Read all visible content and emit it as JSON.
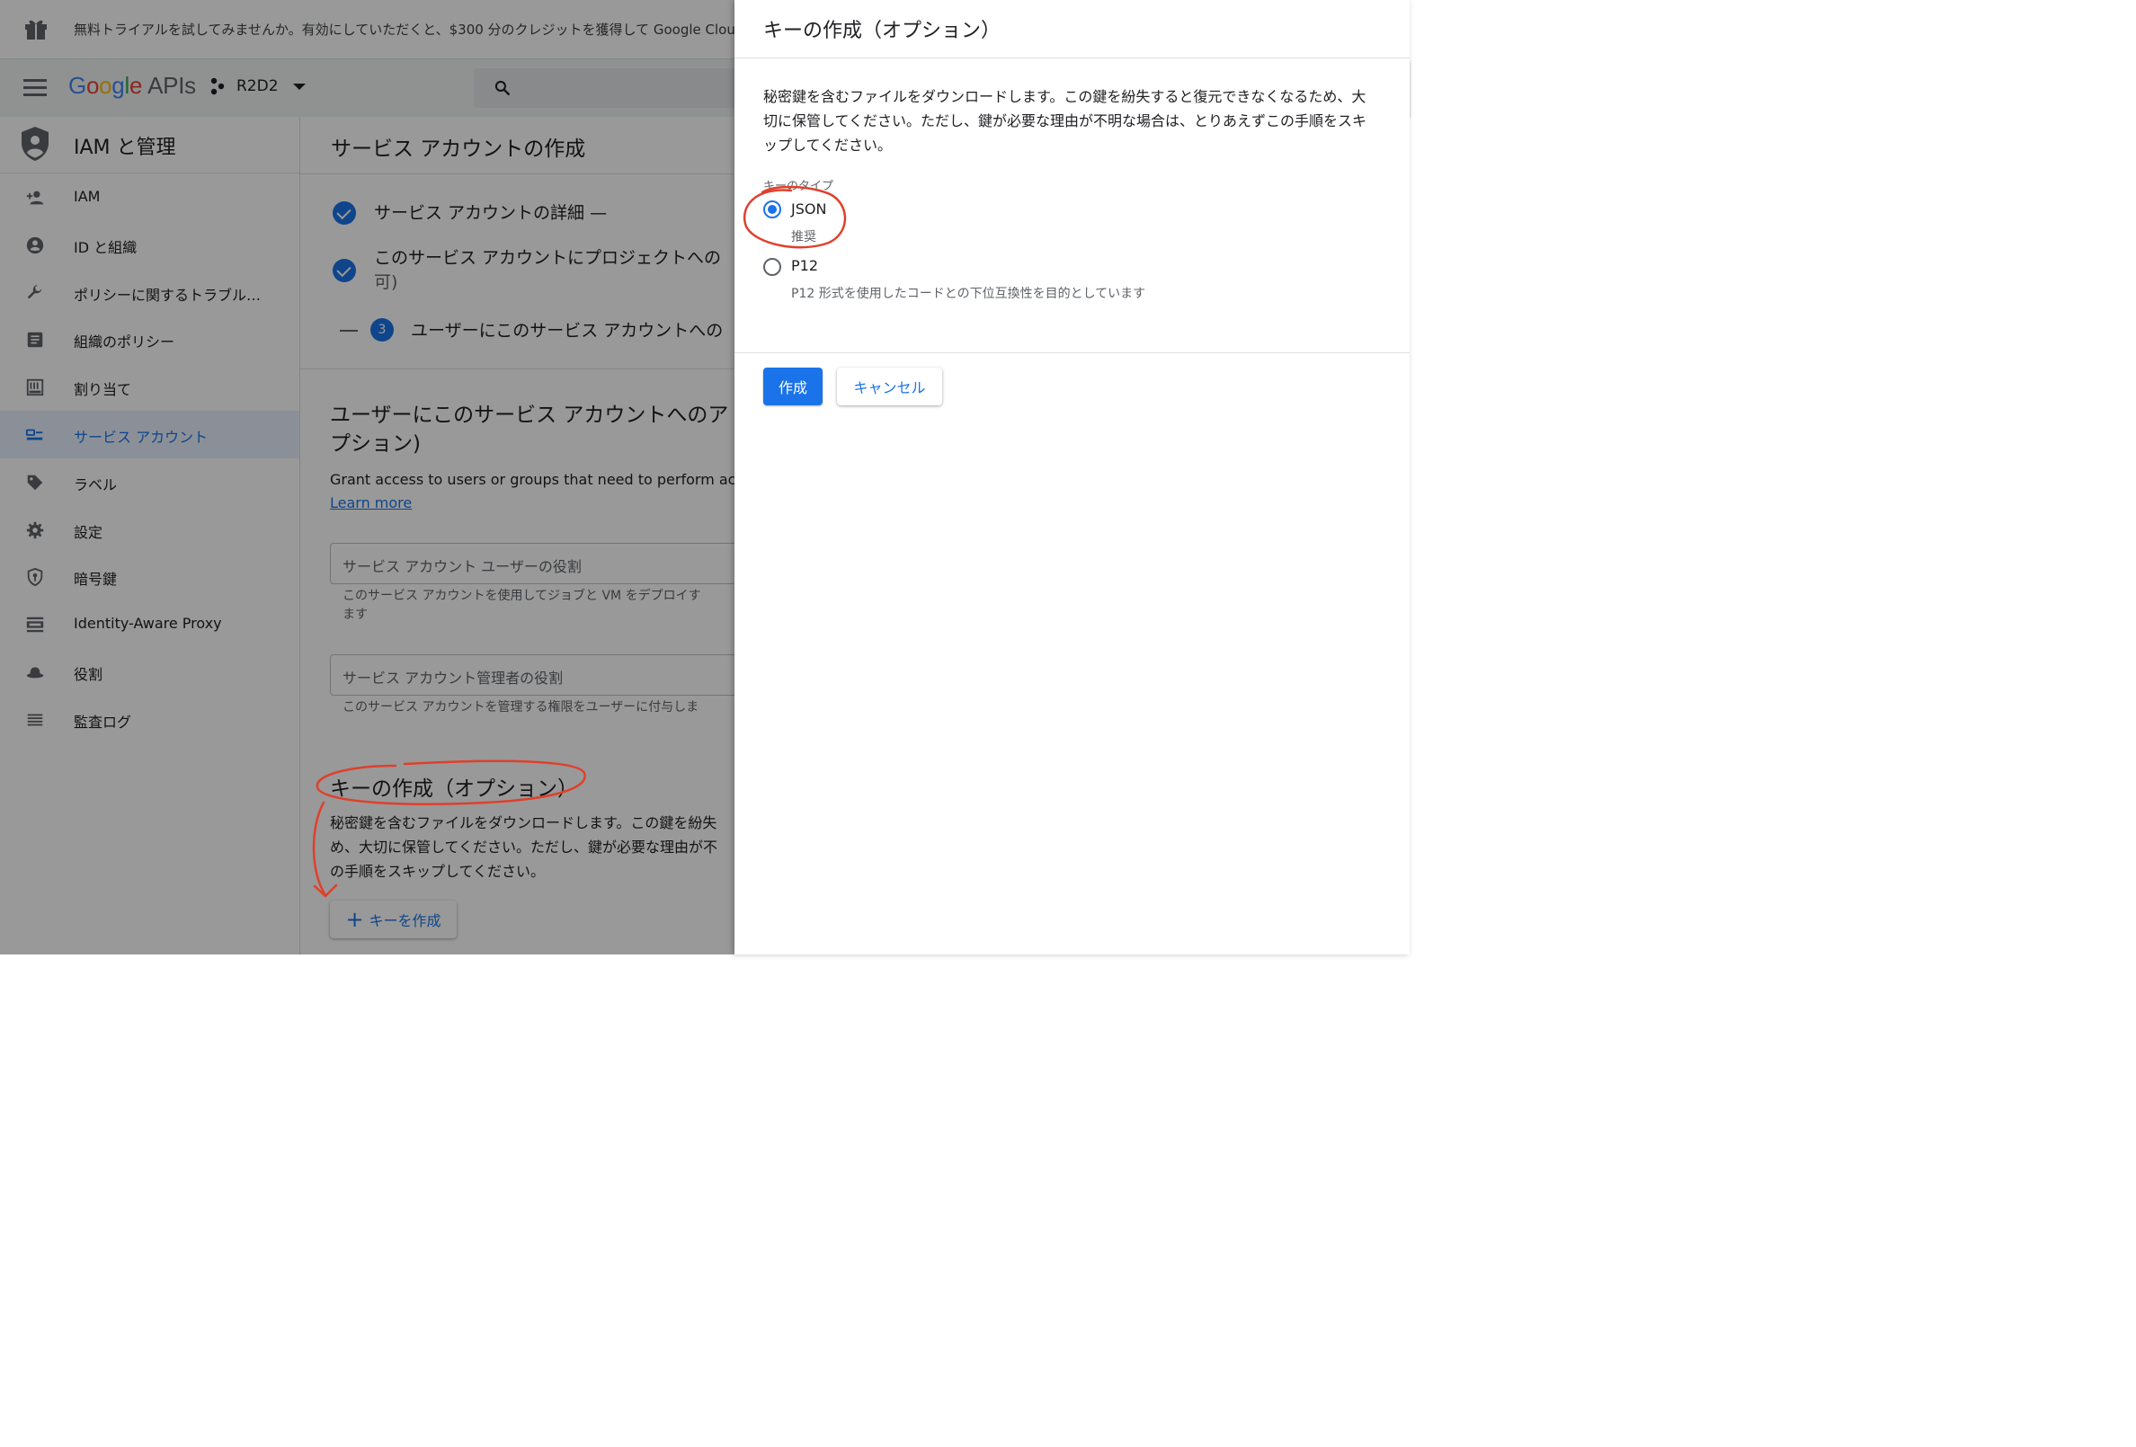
{
  "banner": {
    "text": "無料トライアルを試してみませんか。有効にしていただくと、$300 分のクレジットを獲得して Google Cloud"
  },
  "appbar": {
    "logo_google": "Google",
    "logo_apis": "APIs",
    "project_name": "R2D2"
  },
  "sidebar": {
    "title": "IAM と管理",
    "items": [
      {
        "label": "IAM",
        "icon": "person-add-icon"
      },
      {
        "label": "ID と組織",
        "icon": "account-circle-icon"
      },
      {
        "label": "ポリシーに関するトラブル…",
        "icon": "wrench-icon"
      },
      {
        "label": "組織のポリシー",
        "icon": "list-box-icon"
      },
      {
        "label": "割り当て",
        "icon": "quota-icon"
      },
      {
        "label": "サービス アカウント",
        "icon": "service-account-icon",
        "active": true
      },
      {
        "label": "ラベル",
        "icon": "tag-icon"
      },
      {
        "label": "設定",
        "icon": "gear-icon"
      },
      {
        "label": "暗号鍵",
        "icon": "security-key-icon"
      },
      {
        "label": "Identity-Aware Proxy",
        "icon": "iap-icon"
      },
      {
        "label": "役割",
        "icon": "hat-icon"
      },
      {
        "label": "監査ログ",
        "icon": "log-list-icon"
      }
    ]
  },
  "main": {
    "page_title": "サービス アカウントの作成",
    "steps": [
      {
        "text": "サービス アカウントの詳細 —"
      },
      {
        "text": "このサービス アカウントにプロジェクトへの",
        "text2": "可)"
      },
      {
        "num": "3",
        "text": "ユーザーにこのサービス アカウントへの"
      }
    ],
    "section_title": "ユーザーにこのサービス アカウントへのア",
    "section_title2": "プション)",
    "section_desc": "Grant access to users or groups that need to perform actions",
    "learn_more": "Learn more",
    "field1_placeholder": "サービス アカウント ユーザーの役割",
    "field1_hint": "このサービス アカウントを使用してジョブと VM をデプロイす",
    "field1_hint2": "ます",
    "field2_placeholder": "サービス アカウント管理者の役割",
    "field2_hint": "このサービス アカウントを管理する権限をユーザーに付与しま",
    "key_title": "キーの作成（オプション）",
    "key_desc": "秘密鍵を含むファイルをダウンロードします。この鍵を紛失",
    "key_desc2": "め、大切に保管してください。ただし、鍵が必要な理由が不",
    "key_desc3": "の手順をスキップしてください。",
    "add_key_label": "キーを作成"
  },
  "panel": {
    "title": "キーの作成（オプション）",
    "desc": "秘密鍵を含むファイルをダウンロードします。この鍵を紛失すると復元できなくなるため、大切に保管してください。ただし、鍵が必要な理由が不明な場合は、とりあえずこの手順をスキップしてください。",
    "key_type_label": "キーのタイプ",
    "options": [
      {
        "label": "JSON",
        "sub": "推奨",
        "selected": true
      },
      {
        "label": "P12",
        "sub": "P12 形式を使用したコードとの下位互換性を目的としています",
        "selected": false
      }
    ],
    "create_label": "作成",
    "cancel_label": "キャンセル"
  },
  "colors": {
    "accent": "#1a73e8",
    "annotation": "#e0402b"
  }
}
